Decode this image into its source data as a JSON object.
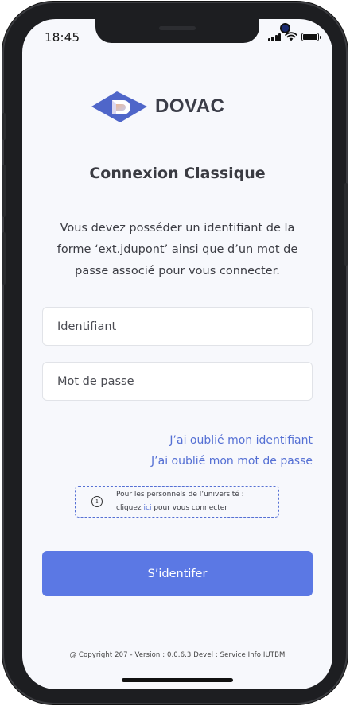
{
  "status_bar": {
    "time": "18:45"
  },
  "brand": {
    "name": "DOVAC",
    "colors": {
      "primary": "#5b78e4",
      "logo_dark": "#4f66c9",
      "link": "#5570d4"
    }
  },
  "login": {
    "title": "Connexion Classique",
    "description": "Vous devez posséder un identifiant de la forme ‘ext.jdupont’ ainsi que d’un mot de passe associé pour vous connecter.",
    "username_placeholder": "Identifiant",
    "password_placeholder": "Mot de passe",
    "forgot_id_label": "J’ai oublié mon identifiant",
    "forgot_password_label": "J’ai oublié mon mot de passe",
    "staff_notice_line1": "Pour les personnels de l’université :",
    "staff_notice_prefix": "cliquez ",
    "staff_notice_link": "ici",
    "staff_notice_suffix": " pour vous connecter",
    "submit_label": "S’identifer"
  },
  "footer": {
    "copyright": "@ Copyright 207 - Version : 0.0.6.3 Devel : Service Info IUTBM"
  },
  "icons": [
    "signal-icon",
    "wifi-icon",
    "battery-icon",
    "dovac-logo-icon",
    "info-icon"
  ]
}
